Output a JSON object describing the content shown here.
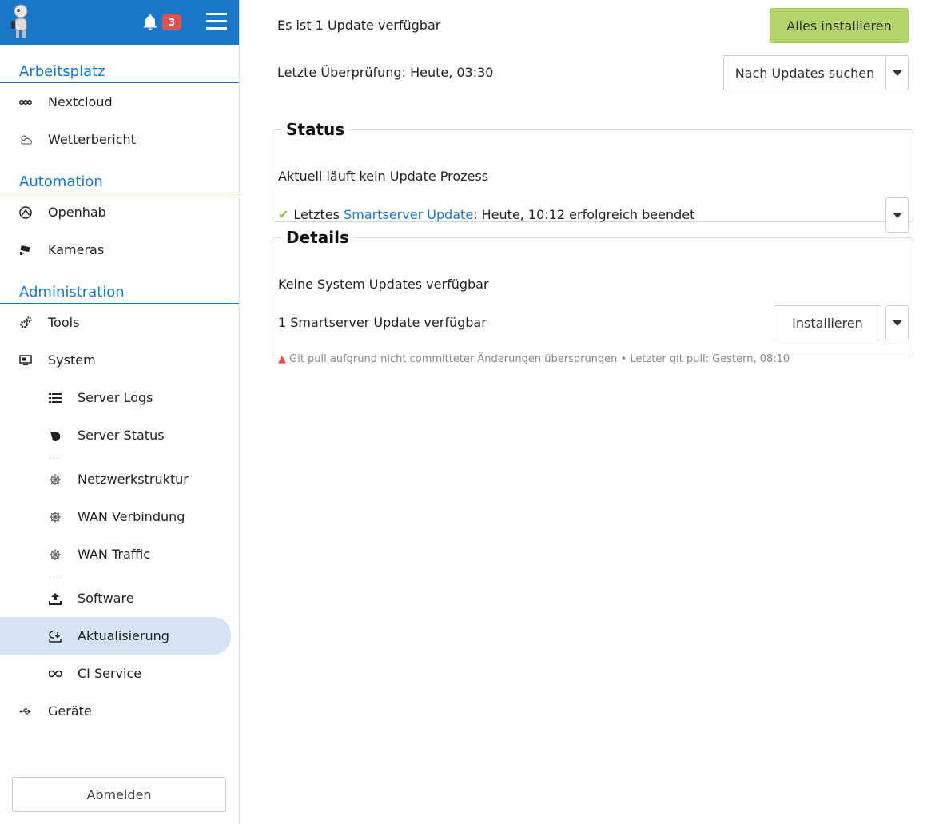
{
  "header": {
    "notification_count": "3"
  },
  "sidebar": {
    "sections": {
      "workspace": "Arbeitsplatz",
      "automation": "Automation",
      "administration": "Administration"
    },
    "items": {
      "nextcloud": "Nextcloud",
      "weather": "Wetterbericht",
      "openhab": "Openhab",
      "cameras": "Kameras",
      "tools": "Tools",
      "system": "System",
      "server_logs": "Server Logs",
      "server_status": "Server Status",
      "network": "Netzwerkstruktur",
      "wan_connection": "WAN Verbindung",
      "wan_traffic": "WAN Traffic",
      "software": "Software",
      "update": "Aktualisierung",
      "ci_service": "CI Service",
      "devices": "Geräte"
    },
    "logout": "Abmelden"
  },
  "main": {
    "summary": "Es ist 1 Update verfügbar",
    "install_all": "Alles installieren",
    "last_check": "Letzte Überprüfung: Heute, 03:30",
    "search_updates": "Nach Updates suchen",
    "status": {
      "legend": "Status",
      "no_process": "Aktuell läuft kein Update Prozess",
      "last_prefix": "Letztes ",
      "last_link": "Smartserver Update",
      "last_suffix": ": Heute, 10:12 erfolgreich beendet"
    },
    "details": {
      "legend": "Details",
      "system_updates": "Keine System Updates verfügbar",
      "smartserver_updates": "1 Smartserver Update verfügbar",
      "install": "Installieren",
      "warning": "Git pull aufgrund nicht committeter Änderungen übersprungen • Letzter git pull: Gestern, 08:10"
    }
  },
  "colors": {
    "brand": "#1976c8",
    "install_all": "#b3d36b",
    "active_item": "#d4e4f3",
    "badge": "#d9534f",
    "success": "#8cbf3f"
  }
}
